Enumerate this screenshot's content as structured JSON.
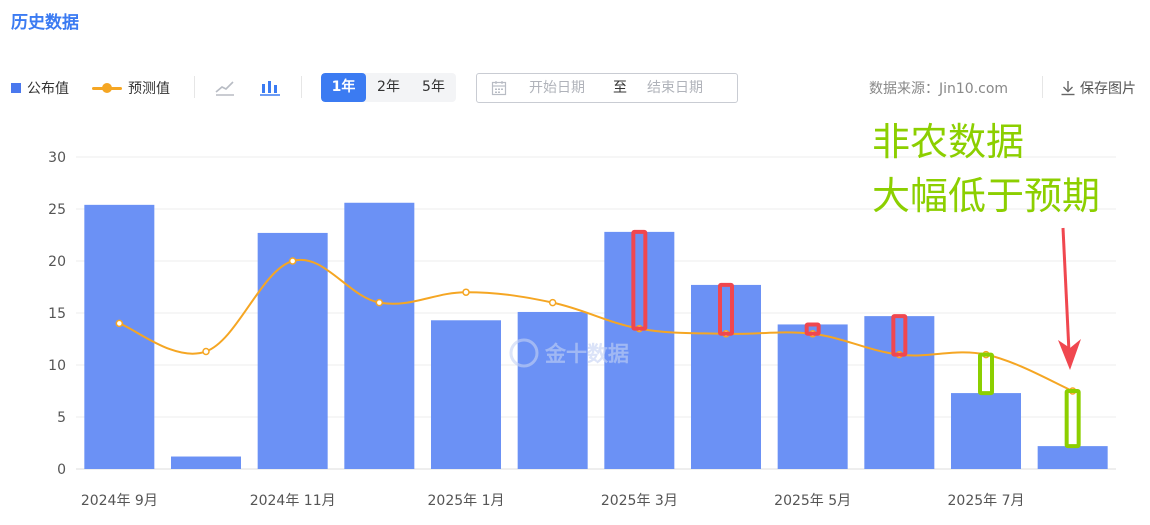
{
  "page": {
    "title": "历史数据"
  },
  "toolbar": {
    "legend": {
      "published": "公布值",
      "forecast": "预测值"
    },
    "icons": {
      "line": "line-chart-icon",
      "bar": "bar-chart-icon",
      "calendar": "calendar-icon",
      "download": "download-icon"
    },
    "ranges": [
      "1年",
      "2年",
      "5年"
    ],
    "active_range": "1年",
    "date": {
      "start_placeholder": "开始日期",
      "separator": "至",
      "end_placeholder": "结束日期"
    },
    "source": "数据来源：Jin10.com",
    "save": "保存图片"
  },
  "watermark": "金十数据",
  "annotation": {
    "line1": "非农数据",
    "line2": "大幅低于预期"
  },
  "colors": {
    "bar": "#6b91f5",
    "forecast": "#f5a623",
    "accent": "#3b7bf2",
    "annot_green": "#8ccf00",
    "annot_red": "#f0474f"
  },
  "chart_data": {
    "type": "bar",
    "categories": [
      "2024年 9月",
      "2024年 10月",
      "2024年 11月",
      "2024年 12月",
      "2025年 1月",
      "2025年 2月",
      "2025年 3月",
      "2025年 4月",
      "2025年 5月",
      "2025年 6月",
      "2025年 7月",
      "2025年 8月"
    ],
    "x_tick_labels": [
      "2024年 9月",
      "",
      "2024年 11月",
      "",
      "2025年 1月",
      "",
      "2025年 3月",
      "",
      "2025年 5月",
      "",
      "2025年 7月",
      ""
    ],
    "series": [
      {
        "name": "公布值",
        "type": "bar",
        "values": [
          25.4,
          1.2,
          22.7,
          25.6,
          14.3,
          15.1,
          22.8,
          17.7,
          13.9,
          14.7,
          7.3,
          2.2
        ]
      },
      {
        "name": "预测值",
        "type": "line",
        "values": [
          14.0,
          11.3,
          20.0,
          16.0,
          17.0,
          16.0,
          13.5,
          13.0,
          13.0,
          11.0,
          11.0,
          7.5
        ]
      }
    ],
    "ylim": [
      0,
      30
    ],
    "yticks": [
      0,
      5,
      10,
      15,
      20,
      25,
      30
    ],
    "grid": true,
    "legend_position": "top-left",
    "highlights": [
      {
        "index": 6,
        "color": "red",
        "from": 13.5,
        "to": 22.8
      },
      {
        "index": 7,
        "color": "red",
        "from": 13.0,
        "to": 17.7
      },
      {
        "index": 8,
        "color": "red",
        "from": 13.0,
        "to": 13.9
      },
      {
        "index": 9,
        "color": "red",
        "from": 11.0,
        "to": 14.7
      },
      {
        "index": 10,
        "color": "green",
        "from": 7.3,
        "to": 11.0
      },
      {
        "index": 11,
        "color": "green",
        "from": 2.2,
        "to": 7.5
      }
    ]
  }
}
